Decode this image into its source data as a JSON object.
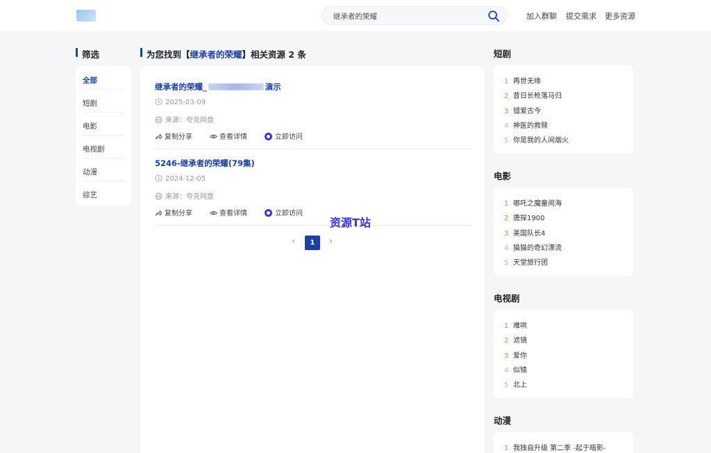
{
  "header": {
    "search": {
      "value": "继承者的荣耀"
    },
    "nav": [
      "加入群聊",
      "提交需求",
      "更多资源"
    ]
  },
  "filter": {
    "title": "筛选",
    "items": [
      "全部",
      "短剧",
      "电影",
      "电视剧",
      "动漫",
      "综艺"
    ]
  },
  "results": {
    "heading_prefix": "为您找到【",
    "keyword": "继承者的荣耀",
    "heading_suffix": "】相关资源 2 条",
    "items": [
      {
        "title_start": "继承者的荣耀_",
        "title_end": "演示",
        "date": "2025-03-09",
        "source": "来源：夸克网盘"
      },
      {
        "title_start": "5246-继承者的荣耀(79集)",
        "title_end": "",
        "date": "2024-12-05",
        "source": "来源：夸克网盘"
      }
    ],
    "actions": {
      "share": "复制分享",
      "detail": "查看详情",
      "visit": "立即访问"
    },
    "pager": {
      "prev": "‹",
      "current": "1",
      "next": "›"
    }
  },
  "watermark": "资源T站",
  "rankings": [
    {
      "title": "短剧",
      "items": [
        "再世无缘",
        "昔日长枪落马归",
        "错爱古今",
        "神医的救赎",
        "你是我的人间烟火"
      ]
    },
    {
      "title": "电影",
      "items": [
        "哪吒之魔童闹海",
        "唐探1900",
        "美国队长4",
        "猫猫的奇幻漂流",
        "天堂旅行团"
      ]
    },
    {
      "title": "电视剧",
      "items": [
        "难哄",
        "滤镜",
        "爱你",
        "似锦",
        "北上"
      ]
    },
    {
      "title": "动漫",
      "items": [
        "我独自升级 第二季 -起于暗影-"
      ]
    }
  ],
  "rank_numbers": [
    "1",
    "2",
    "3",
    "4",
    "5"
  ],
  "colors": {
    "accent": "#1b3fa5",
    "visit": "#3a31d6",
    "rank_hot": "#e08a3a",
    "rank_cool": "#bbbbbb"
  }
}
